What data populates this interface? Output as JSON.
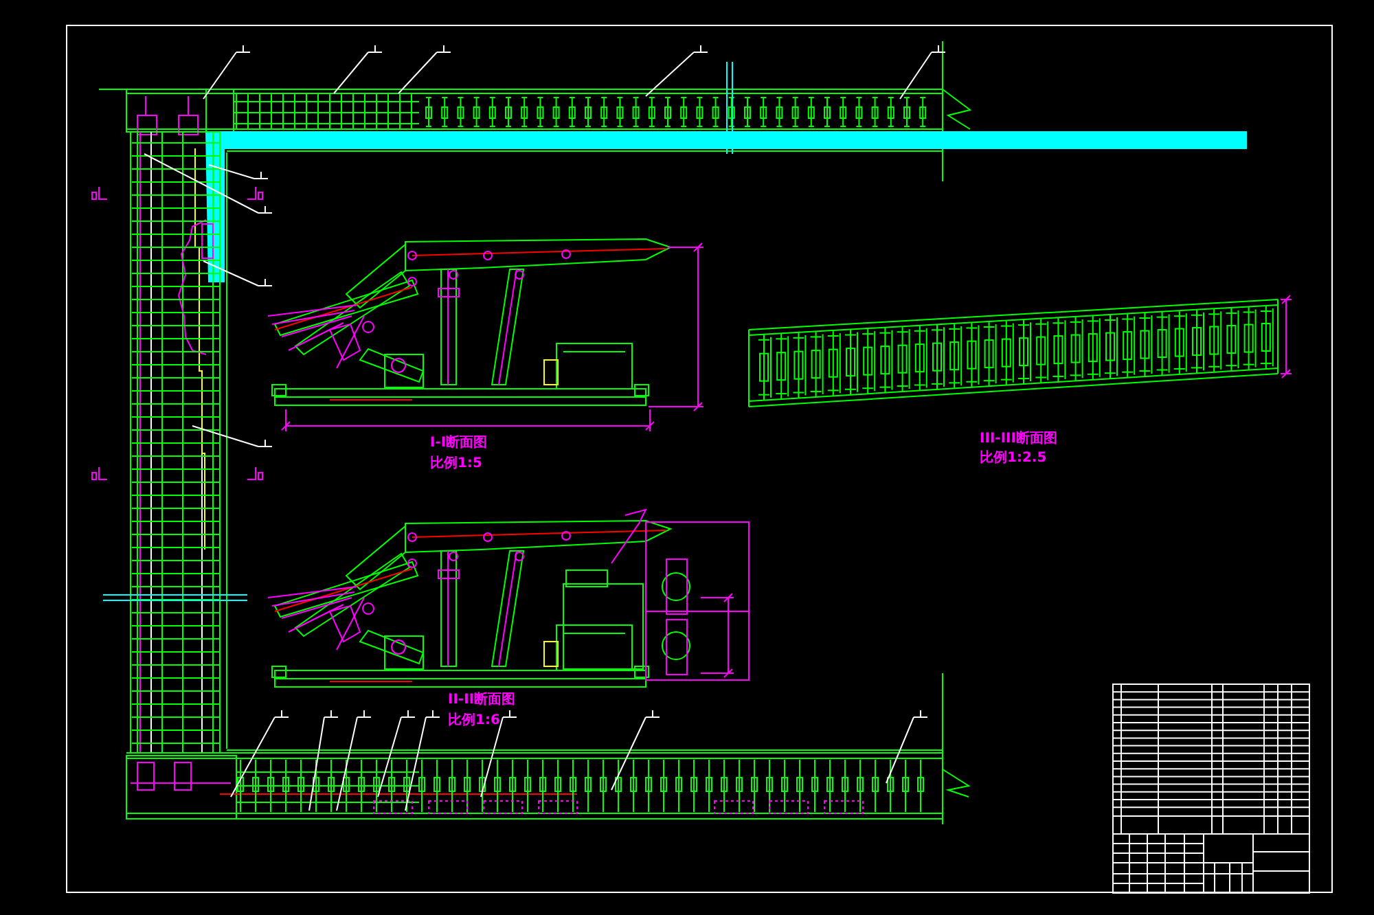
{
  "drawing": {
    "views": [
      {
        "title": "I-I断面图",
        "scale": "比例1:5"
      },
      {
        "title": "III-III断面图",
        "scale": "比例1:2.5"
      },
      {
        "title": "II-II断面图",
        "scale": "比例1:6"
      }
    ]
  }
}
